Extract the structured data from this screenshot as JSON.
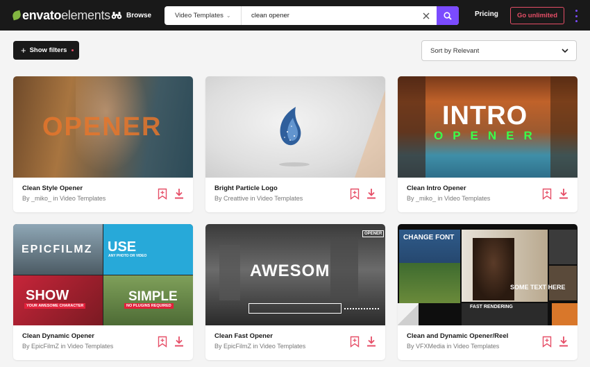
{
  "header": {
    "logo_bold": "envato",
    "logo_light": "elements",
    "browse_label": "Browse",
    "search": {
      "category": "Video Templates",
      "query": "clean opener"
    },
    "pricing_label": "Pricing",
    "cta_label": "Go unlimited"
  },
  "toolbar": {
    "filters_label": "Show filters",
    "sort_label": "Sort by Relevant"
  },
  "cards": [
    {
      "title": "Clean Style Opener",
      "meta": "By _miko_ in Video Templates",
      "thumb_text": "OPENER"
    },
    {
      "title": "Bright Particle Logo",
      "meta": "By Creattive in Video Templates",
      "thumb_text": ""
    },
    {
      "title": "Clean Intro Opener",
      "meta": "By _miko_ in Video Templates",
      "thumb_text": "INTRO",
      "thumb_sub": "OPENER"
    },
    {
      "title": "Clean Dynamic Opener",
      "meta": "By EpicFilmZ in Video Templates",
      "thumb_texts": [
        "EPICFILMZ",
        "USE",
        "ANY PHOTO OR VIDEO",
        "SHOW",
        "YOUR AWESOME CHARACTER",
        "SIMPLE",
        "NO PLUGINS REQUIRED"
      ]
    },
    {
      "title": "Clean Fast Opener",
      "meta": "By EpicFilmZ in Video Templates",
      "thumb_text": "AWESOM",
      "thumb_badge": "OPENER"
    },
    {
      "title": "Clean and Dynamic Opener/Reel",
      "meta": "By VFXMedia in Video Templates",
      "thumb_texts": [
        "CHANGE FONT",
        "SOME TEXT HERE",
        "FAST RENDERING"
      ]
    }
  ],
  "colors": {
    "accent_purple": "#7b4bff",
    "accent_red": "#e64e67",
    "logo_green": "#82b541",
    "header_bg": "#191919"
  },
  "icons": [
    "binoculars-icon",
    "chevron-down-icon",
    "close-icon",
    "search-icon",
    "plus-icon",
    "bookmark-add-icon",
    "download-icon",
    "kebab-menu-icon"
  ]
}
